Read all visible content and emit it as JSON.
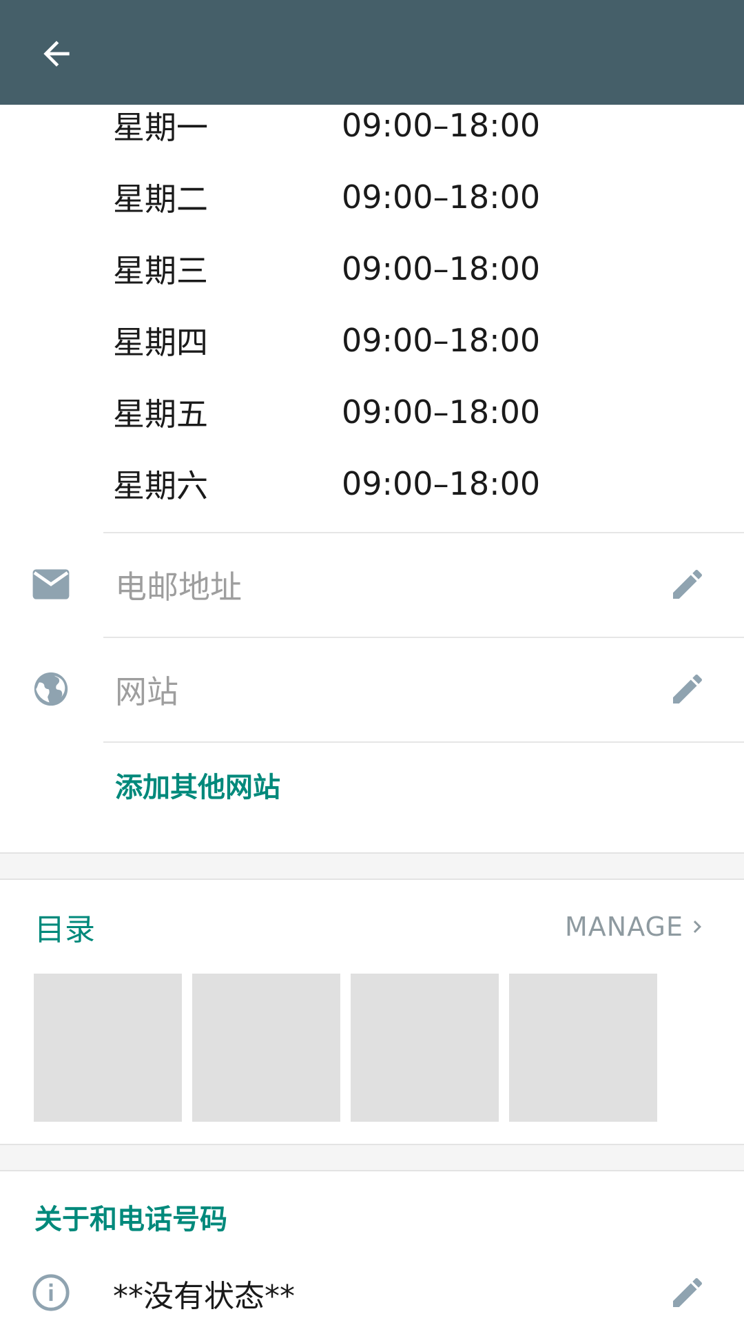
{
  "header": {
    "back_icon": "arrow-left-icon",
    "color": "#455f69"
  },
  "hours": [
    {
      "day": "星期一",
      "time": "09:00–18:00"
    },
    {
      "day": "星期二",
      "time": "09:00–18:00"
    },
    {
      "day": "星期三",
      "time": "09:00–18:00"
    },
    {
      "day": "星期四",
      "time": "09:00–18:00"
    },
    {
      "day": "星期五",
      "time": "09:00–18:00"
    },
    {
      "day": "星期六",
      "time": "09:00–18:00"
    }
  ],
  "contact": {
    "email_placeholder": "电邮地址",
    "website_placeholder": "网站",
    "add_website_label": "添加其他网站"
  },
  "catalog": {
    "title": "目录",
    "manage_label": "MANAGE",
    "items_count": 4
  },
  "about": {
    "title": "关于和电话号码",
    "status": "**没有状态**"
  },
  "colors": {
    "accent": "#00897b",
    "icon_gray": "#8fa3b0"
  }
}
